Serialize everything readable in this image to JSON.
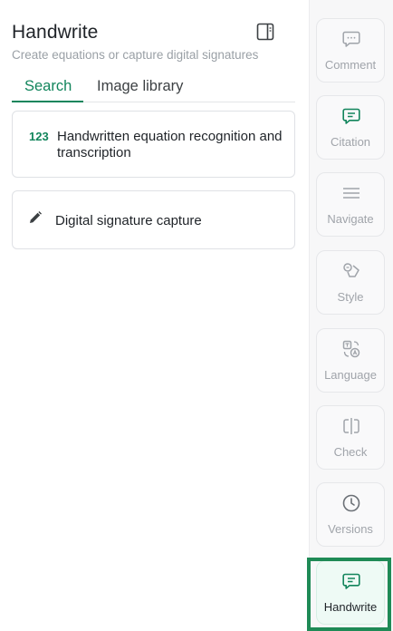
{
  "panel": {
    "title": "Handwrite",
    "subtitle": "Create equations or capture digital signatures",
    "toggle_icon": "sidebar-toggle-icon"
  },
  "tabs": [
    {
      "label": "Search",
      "active": true
    },
    {
      "label": "Image library",
      "active": false
    }
  ],
  "cards": [
    {
      "icon_text": "123",
      "label": "Handwritten equation recognition and transcription"
    },
    {
      "icon": "pencil-icon",
      "label": "Digital signature capture"
    }
  ],
  "rail": [
    {
      "label": "Comment",
      "icon": "comment-icon"
    },
    {
      "label": "Citation",
      "icon": "citation-icon"
    },
    {
      "label": "Navigate",
      "icon": "menu-lines-icon"
    },
    {
      "label": "Style",
      "icon": "style-shapes-icon"
    },
    {
      "label": "Language",
      "icon": "translate-icon"
    },
    {
      "label": "Check",
      "icon": "check-text-icon"
    },
    {
      "label": "Versions",
      "icon": "clock-icon"
    },
    {
      "label": "Handwrite",
      "icon": "handwrite-icon",
      "active": true
    }
  ],
  "colors": {
    "accent": "#12855c",
    "highlight": "#1f8a56",
    "muted": "#a0a4aa"
  }
}
